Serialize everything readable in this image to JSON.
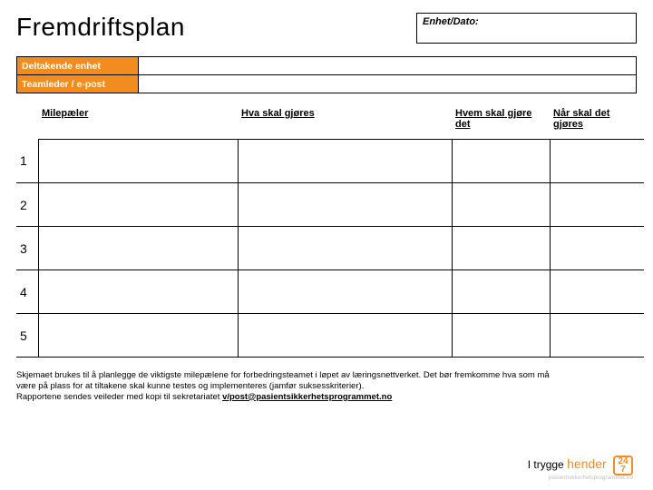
{
  "title": "Fremdriftsplan",
  "meta": {
    "label": "Enhet/Dato:",
    "value": ""
  },
  "info": {
    "rows": [
      {
        "label": "Deltakende enhet",
        "value": ""
      },
      {
        "label": "Teamleder / e-post",
        "value": ""
      }
    ]
  },
  "grid": {
    "headers": {
      "milestones": "Milepæler",
      "what": "Hva skal gjøres",
      "who": "Hvem skal gjøre det",
      "when": "Når skal det gjøres"
    },
    "rows": [
      {
        "n": "1",
        "a": "",
        "b": "",
        "c": "",
        "d": ""
      },
      {
        "n": "2",
        "a": "",
        "b": "",
        "c": "",
        "d": ""
      },
      {
        "n": "3",
        "a": "",
        "b": "",
        "c": "",
        "d": ""
      },
      {
        "n": "4",
        "a": "",
        "b": "",
        "c": "",
        "d": ""
      },
      {
        "n": "5",
        "a": "",
        "b": "",
        "c": "",
        "d": ""
      }
    ]
  },
  "footnote": {
    "line1": "Skjemaet brukes til å planlegge de viktigste milepælene for forbedringsteamet i løpet av læringsnettverket. Det bør fremkomme hva som må være på plass for at tiltakene skal kunne testes og implementeres (jamfør suksesskriterier).",
    "line2a": "Rapportene sendes veileder med kopi til sekretariatet ",
    "email": "v/post@pasientsikkerhetsprogrammet.no"
  },
  "footer": {
    "brand_prefix": "I trygge ",
    "brand_accent": "hender",
    "sub": "pasientsikkerhetsprogrammet.no",
    "badge_top": "24",
    "badge_bottom": "7"
  }
}
